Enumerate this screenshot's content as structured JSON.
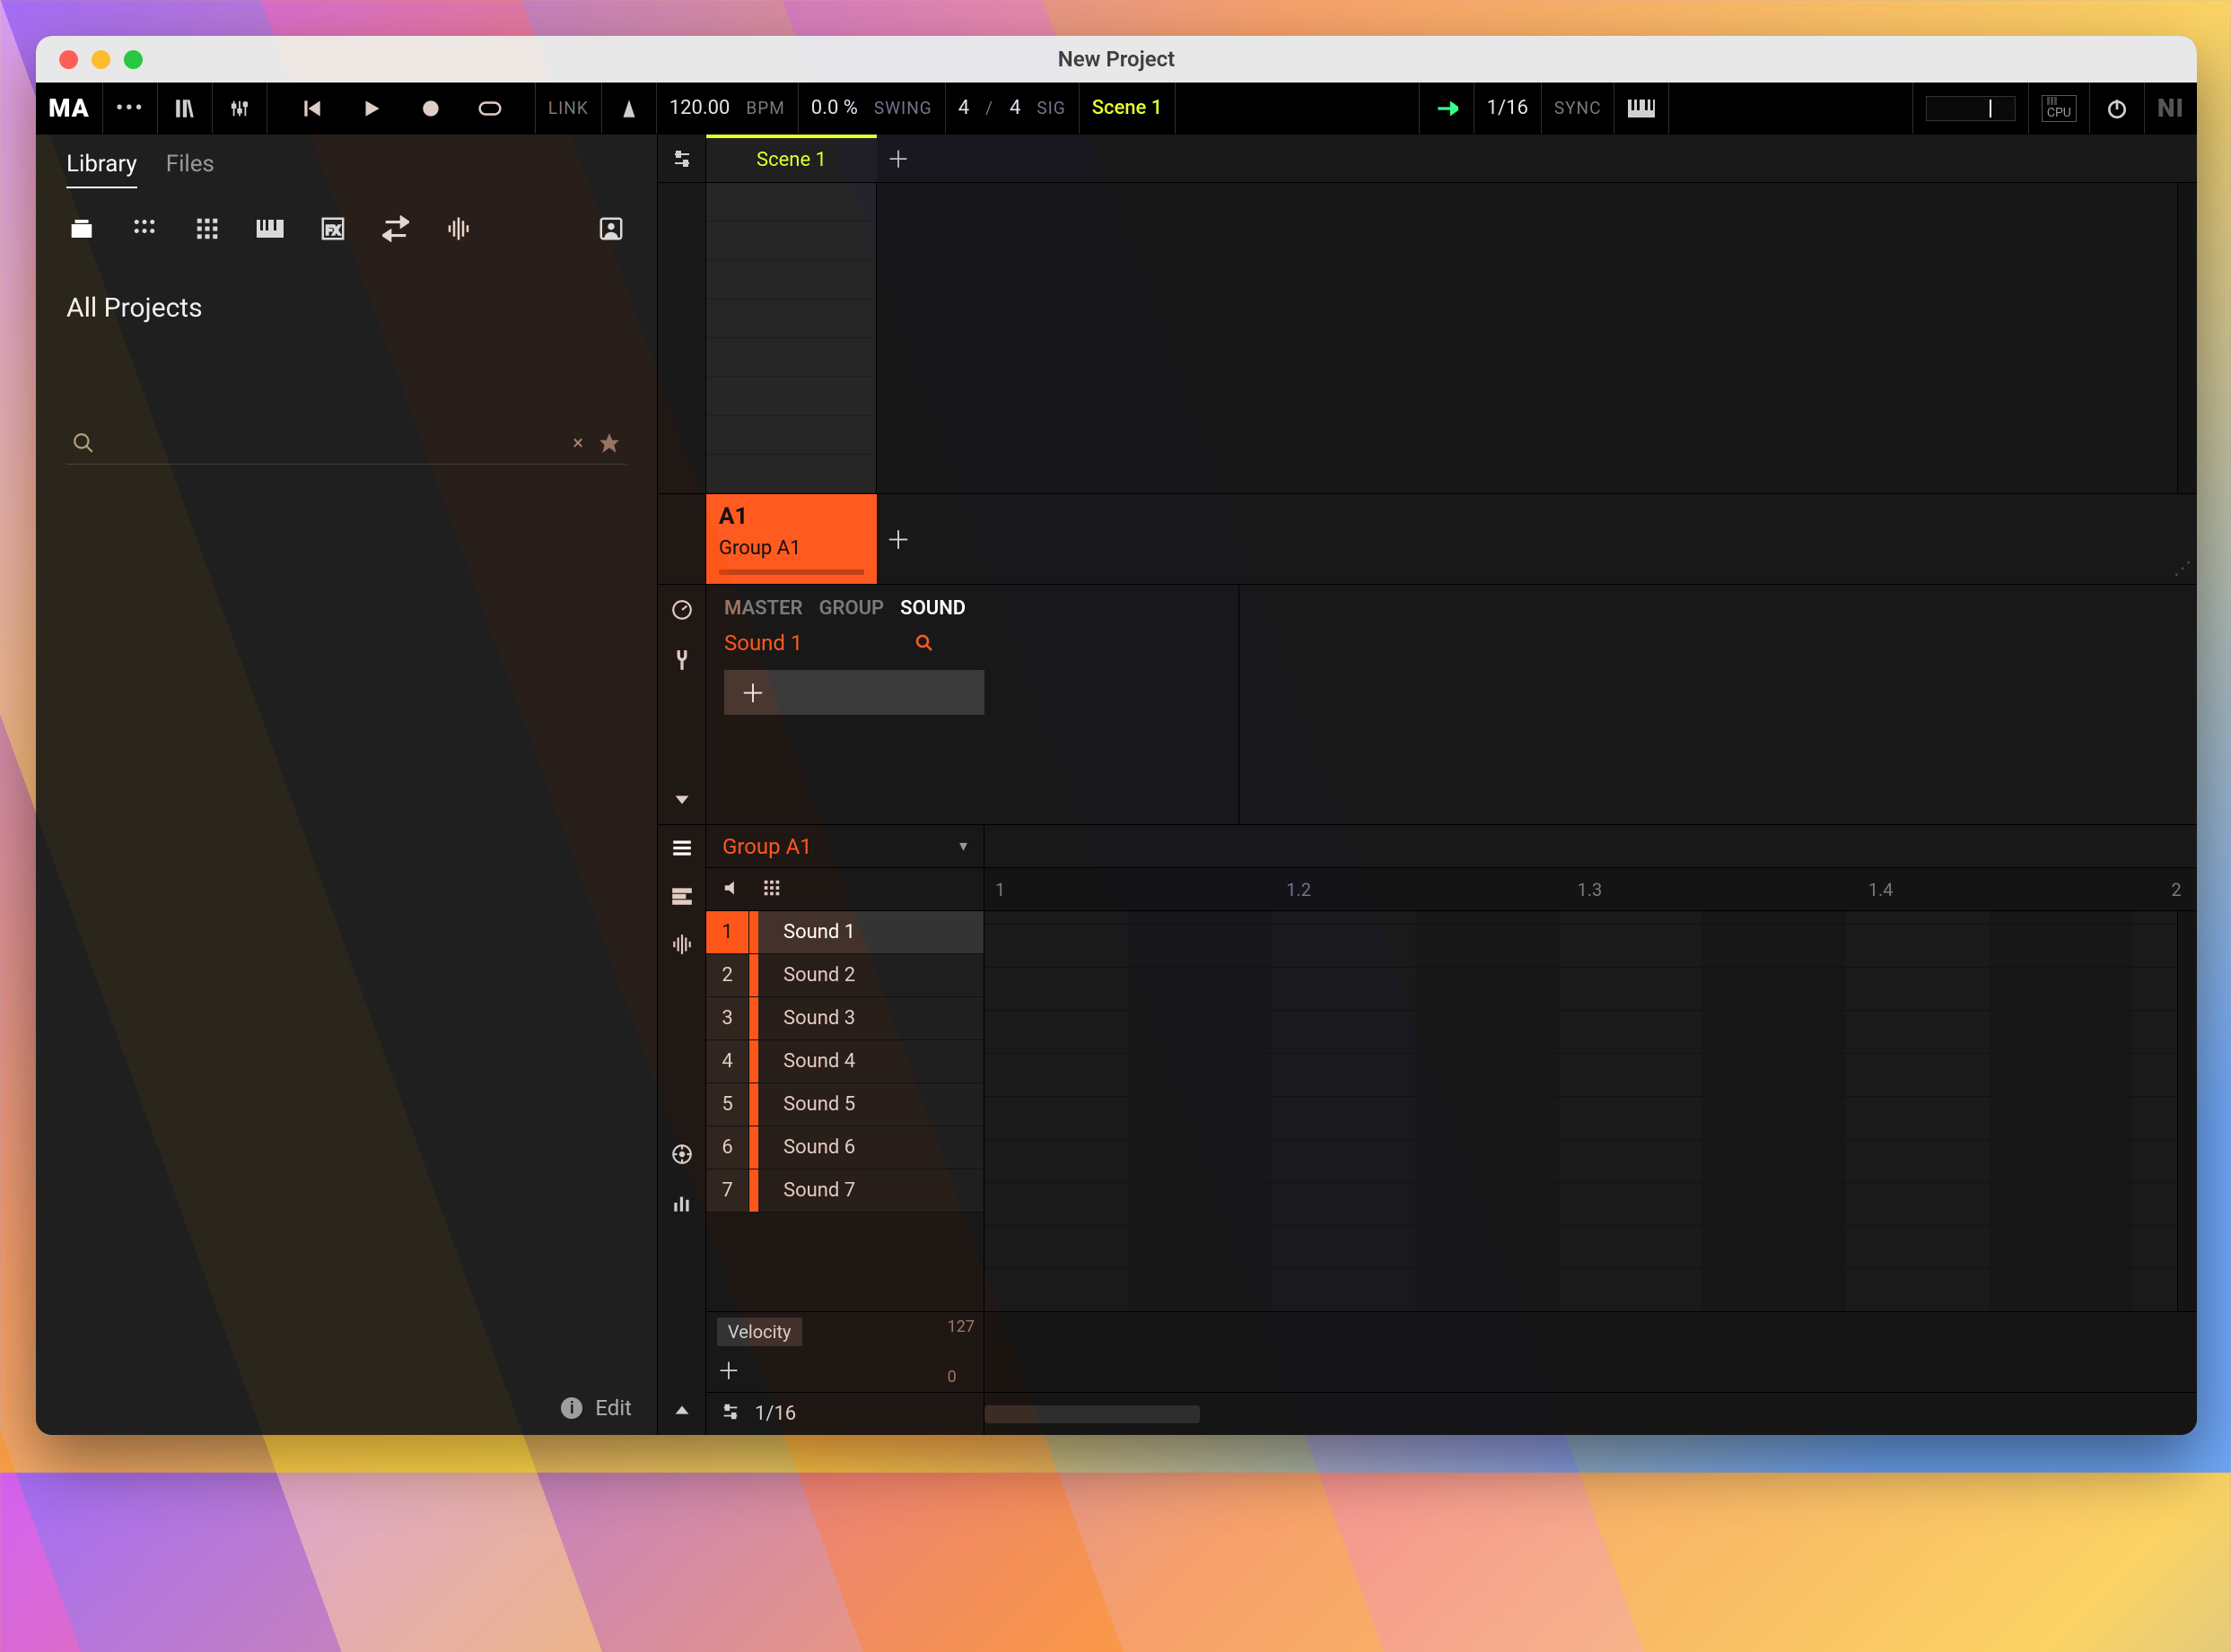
{
  "window": {
    "title": "New Project"
  },
  "toolbar": {
    "logo": "MA",
    "link": "LINK",
    "bpm_value": "120.00",
    "bpm_label": "BPM",
    "swing_value": "0.0 %",
    "swing_label": "SWING",
    "sig_num": "4",
    "sig_sep": "/",
    "sig_den": "4",
    "sig_label": "SIG",
    "scene": "Scene 1",
    "grid": "1/16",
    "sync": "SYNC",
    "cpu_label": "CPU",
    "ni": "NI"
  },
  "browser": {
    "tabs": {
      "library": "Library",
      "files": "Files"
    },
    "heading": "All Projects",
    "search_placeholder": "",
    "edit": "Edit"
  },
  "arranger": {
    "scene_tab": "Scene 1",
    "group": {
      "code": "A1",
      "name": "Group A1"
    }
  },
  "plugin": {
    "tabs": {
      "master": "MASTER",
      "group": "GROUP",
      "sound": "SOUND"
    },
    "sound_name": "Sound 1"
  },
  "pattern": {
    "group": "Group A1",
    "ruler": [
      "1",
      "1.2",
      "1.3",
      "1.4",
      "2"
    ],
    "tracks": [
      {
        "num": "1",
        "name": "Sound 1",
        "selected": true
      },
      {
        "num": "2",
        "name": "Sound 2",
        "selected": false
      },
      {
        "num": "3",
        "name": "Sound 3",
        "selected": false
      },
      {
        "num": "4",
        "name": "Sound 4",
        "selected": false
      },
      {
        "num": "5",
        "name": "Sound 5",
        "selected": false
      },
      {
        "num": "6",
        "name": "Sound 6",
        "selected": false
      },
      {
        "num": "7",
        "name": "Sound 7",
        "selected": false
      }
    ],
    "lane": {
      "name": "Velocity",
      "max": "127",
      "min": "0"
    },
    "bottom_grid": "1/16"
  }
}
